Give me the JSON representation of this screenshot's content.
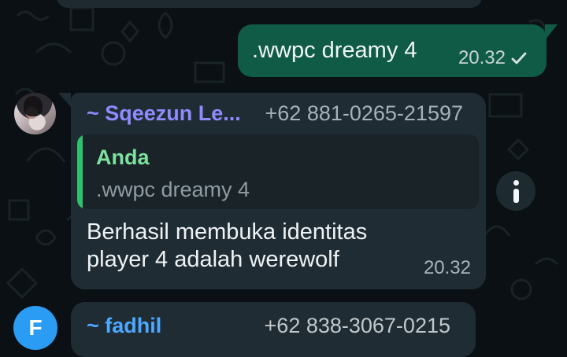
{
  "top_fragment": {},
  "outgoing_message": {
    "text": ".wwpc dreamy 4",
    "time": "20.32"
  },
  "incoming_message": {
    "sender_name": "~ Sqeezun Le...",
    "sender_phone": "+62 881-0265-21597",
    "quote_author": "Anda",
    "quote_text": ".wwpc dreamy 4",
    "body_line_1": "Berhasil membuka identitas",
    "body_line_2": "player 4 adalah werewolf",
    "time": "20.32"
  },
  "next_message": {
    "avatar_letter": "F",
    "sender_name": "~ fadhil",
    "sender_phone": "+62 838-3067-0215"
  },
  "colors": {
    "wallpaper": "#0b1014",
    "incoming_bubble": "#202c33",
    "outgoing_bubble": "#0f5b45",
    "quote_bar": "#2ec36b",
    "sender_name_purple": "#8f8bff",
    "sender_name_blue": "#4da8ff"
  },
  "icons": {
    "check": "check-icon",
    "info": "info-icon"
  }
}
